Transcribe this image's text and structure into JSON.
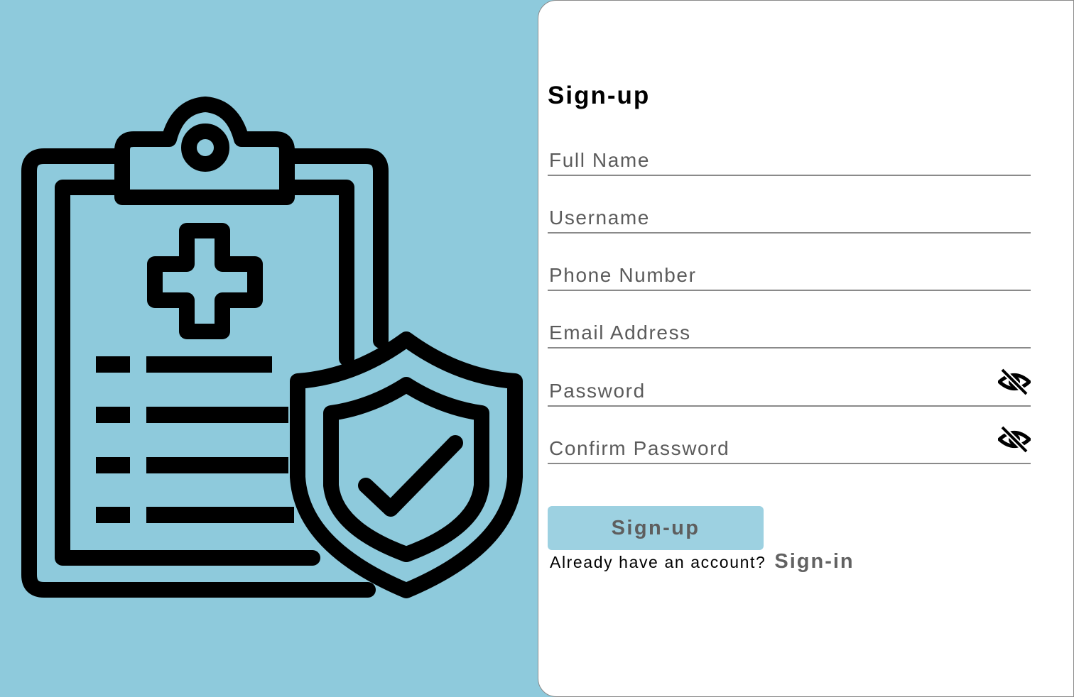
{
  "form": {
    "title": "Sign-up",
    "fields": [
      {
        "placeholder": "Full Name",
        "value": ""
      },
      {
        "placeholder": "Username",
        "value": ""
      },
      {
        "placeholder": "Phone Number",
        "value": ""
      },
      {
        "placeholder": "Email Address",
        "value": ""
      },
      {
        "placeholder": "Password",
        "value": "",
        "toggle_icon": "eye-slash-icon"
      },
      {
        "placeholder": "Confirm Password",
        "value": "",
        "toggle_icon": "eye-slash-icon"
      }
    ],
    "submit_label": "Sign-up",
    "signin_prompt": "Already have an account?",
    "signin_link": "Sign-in"
  },
  "illustration": {
    "icon": "medical-clipboard-shield-icon"
  },
  "colors": {
    "background": "#8ecadc",
    "panel": "#ffffff",
    "button": "#9dd1e1",
    "underline": "#8a8a8a",
    "muted_text": "#5b5b5b"
  }
}
